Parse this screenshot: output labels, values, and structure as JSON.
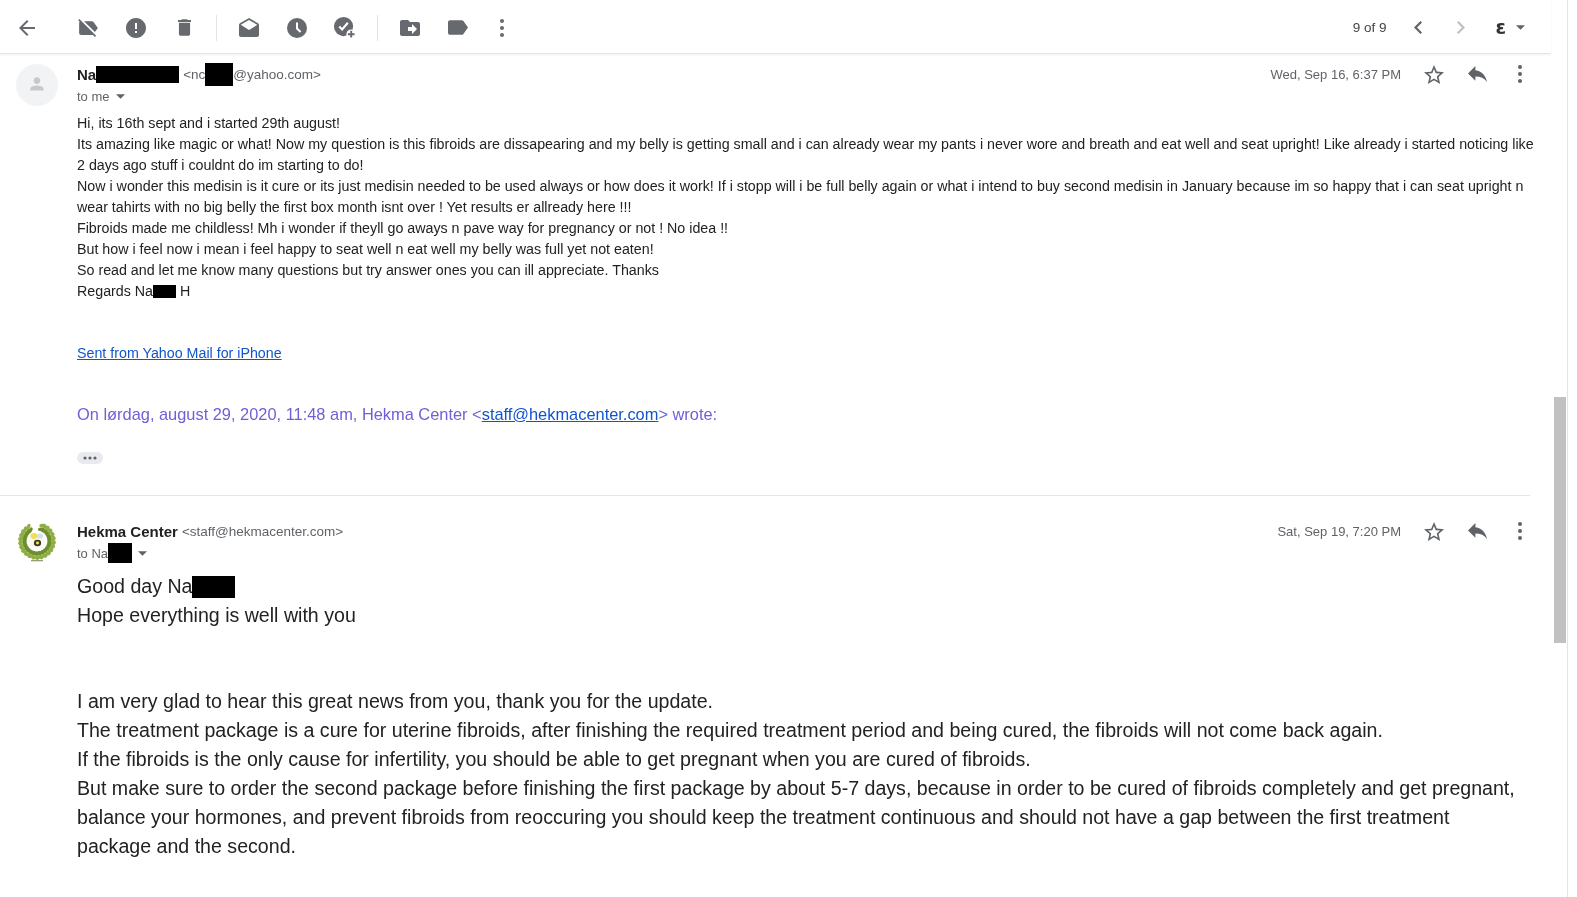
{
  "toolbar": {
    "pager": {
      "counter": "9 of 9",
      "newer": {
        "disabled": false
      },
      "older": {
        "disabled": true
      }
    },
    "account": {
      "glyph": "ɛ"
    }
  },
  "messages": [
    {
      "kind": "plain",
      "avatar": {
        "kind": "silhouette"
      },
      "sender": {
        "name": [
          {
            "kind": "text",
            "text": "Na"
          },
          {
            "kind": "redaction"
          }
        ],
        "email": [
          {
            "kind": "text",
            "text": "<nc"
          },
          {
            "kind": "redaction"
          },
          {
            "kind": "text",
            "text": "@yahoo.com>"
          }
        ]
      },
      "recipient": [
        {
          "kind": "text",
          "text": "to me"
        }
      ],
      "date": "Wed, Sep 16, 6:37 PM",
      "starred": false,
      "body_blocks": [
        {
          "paragraphs": [
            "Hi, its 16th sept and i started 29th august!",
            "Its amazing like magic or what! Now my question is this fibroids are dissapearing and my belly is getting small and i can already wear my pants i never wore and breath and eat well and seat upright! Like already i started noticing like 2 days ago stuff i couldnt do im starting to do!",
            "Now i wonder this medisin is it cure or its just medisin needed to be used always or how does it work! If i stopp will i be full belly again or what i intend to buy second medisin in January because im so happy that i can seat upright n wear tahirts with no big belly the first box month isnt over ! Yet results er allready here !!!",
            "Fibroids made me childless! Mh i wonder if theyll go aways n pave way for pregnancy or not ! No idea !!",
            "But how i feel now i mean i feel happy to seat well n eat well my belly was full yet not eaten!",
            "So read and let me know many questions but try answer ones you can ill appreciate. Thanks",
            [
              {
                "kind": "text",
                "text": "Regards Na"
              },
              {
                "kind": "redaction"
              },
              {
                "kind": "text",
                "text": " H"
              }
            ]
          ]
        }
      ],
      "signature_link": "Sent from Yahoo Mail for iPhone",
      "quote_header": {
        "before": "On lørdag, august 29, 2020, 11:48 am, Hekma Center <",
        "link": "staff@hekmacenter.com",
        "after": "> wrote:"
      },
      "trimmed": true
    },
    {
      "kind": "rich",
      "avatar": {
        "kind": "logo"
      },
      "sender": {
        "name": [
          {
            "kind": "text",
            "text": "Hekma Center"
          }
        ],
        "email": [
          {
            "kind": "text",
            "text": "<staff@hekmacenter.com>"
          }
        ]
      },
      "recipient": [
        {
          "kind": "text",
          "text": "to Na"
        },
        {
          "kind": "redaction"
        }
      ],
      "date": "Sat, Sep 19, 7:20 PM",
      "starred": false,
      "body_blocks": [
        {
          "paragraphs": [
            [
              {
                "kind": "text",
                "text": "Good day Na"
              },
              {
                "kind": "redaction"
              }
            ],
            "Hope everything is well with you"
          ]
        },
        {
          "paragraphs": [
            "I am very glad to hear this great news from you, thank you for the update.",
            "The treatment package is a cure for uterine fibroids, after finishing the required treatment period and being cured, the fibroids will not come back again.",
            "If the fibroids is the only cause for infertility, you should be able to get pregnant when you are cured of fibroids.",
            "But make sure to order the second package before finishing the first package by about 5-7 days, because in order to be cured of fibroids completely and get pregnant, balance your hormones, and prevent fibroids from reoccuring you should keep the treatment continuous and should not have a gap between the first treatment package and the second."
          ]
        }
      ]
    }
  ]
}
